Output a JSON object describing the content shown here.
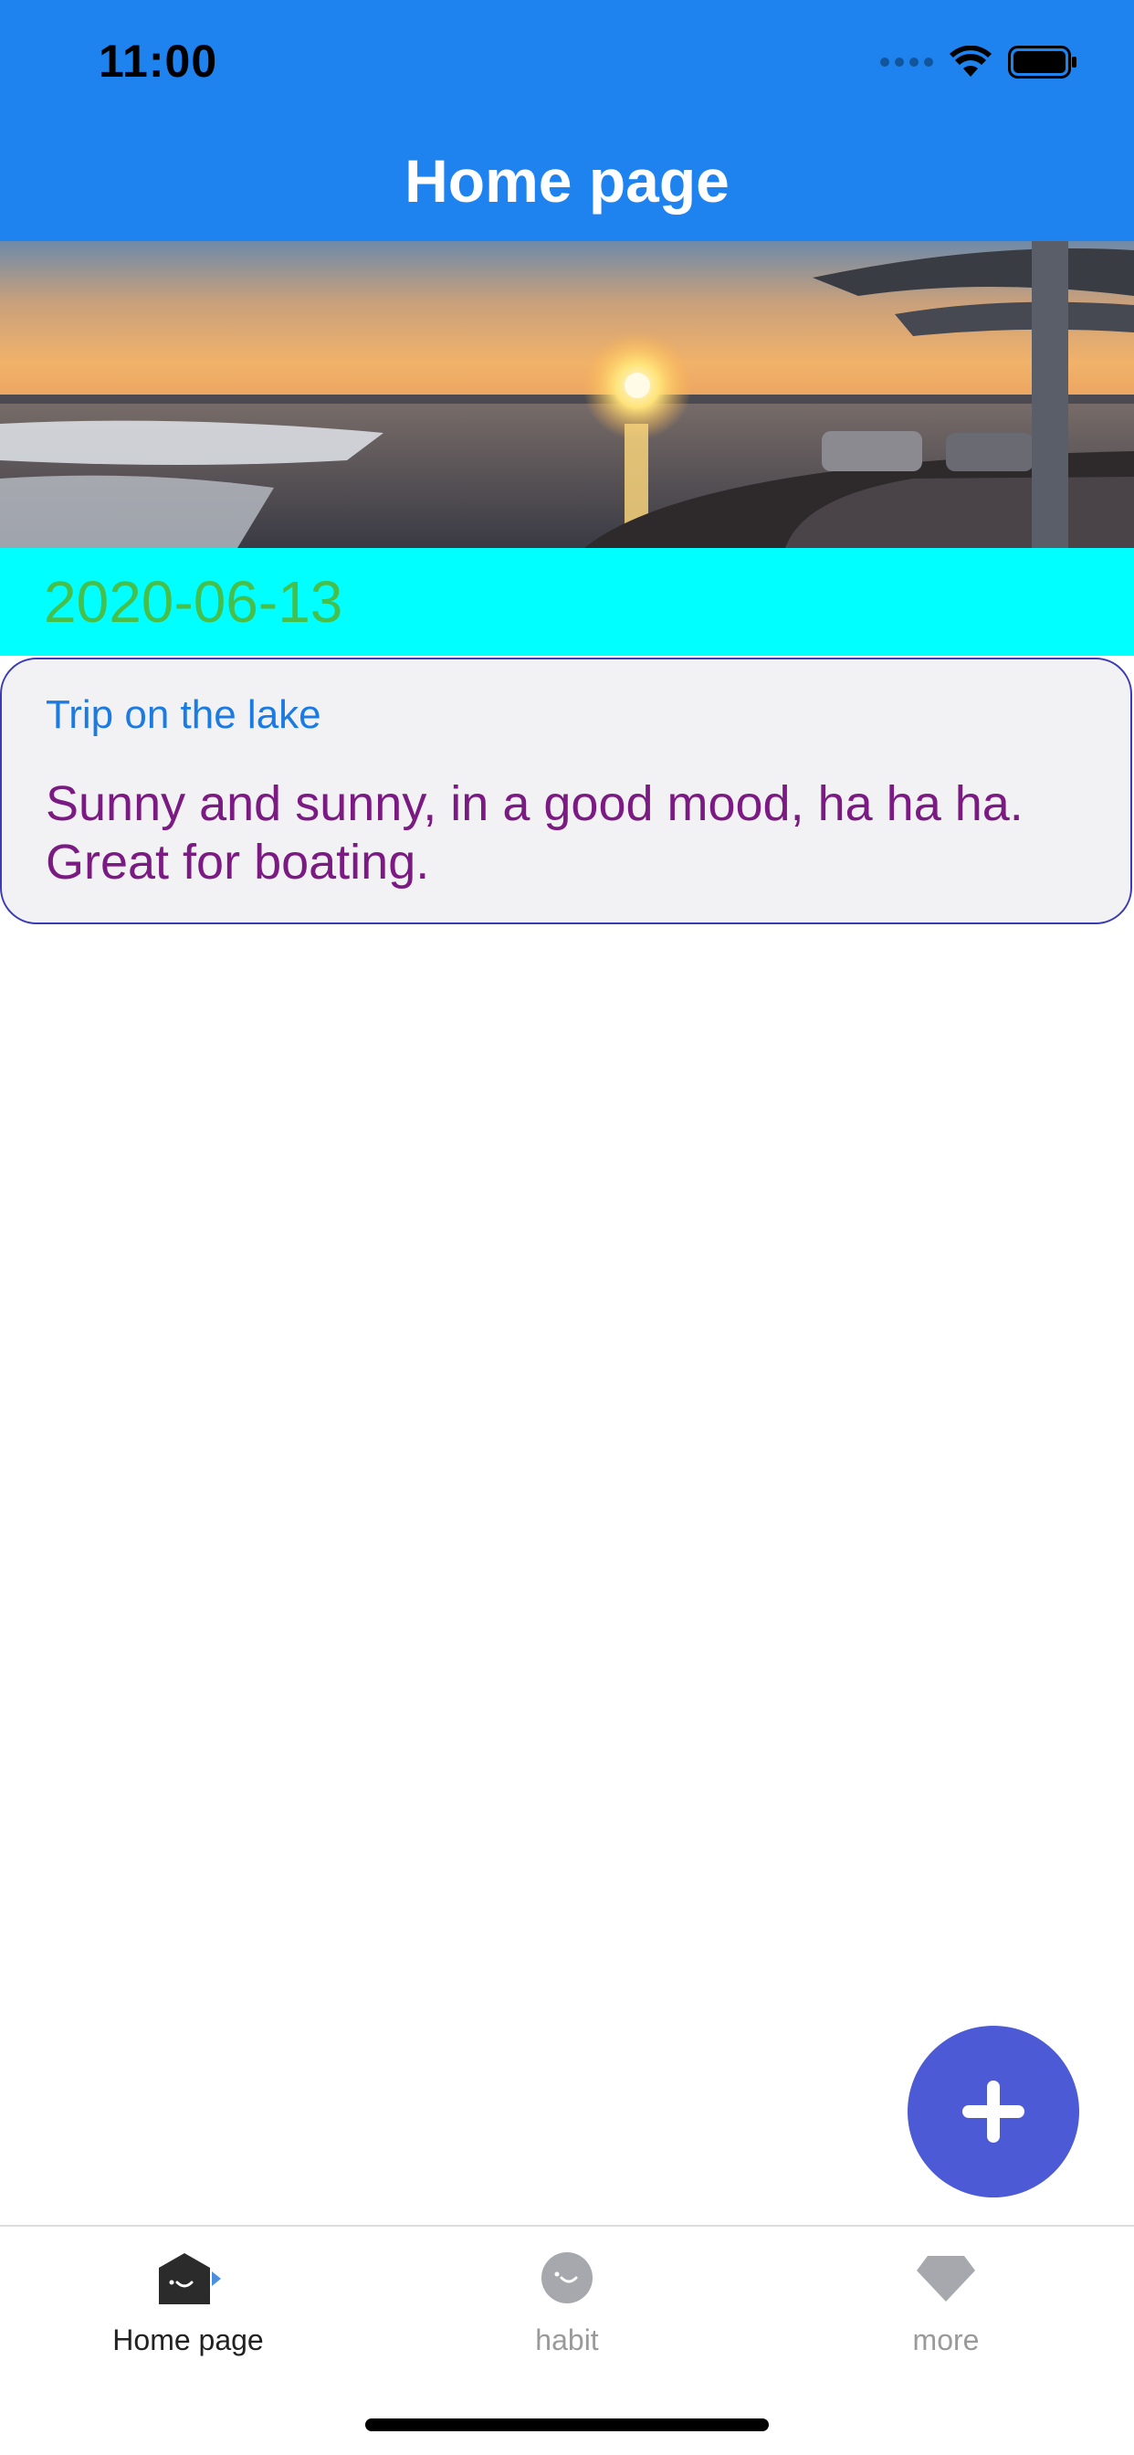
{
  "status_bar": {
    "time": "11:00"
  },
  "nav": {
    "title": "Home page"
  },
  "banner": {
    "image": "sunset-lake-photo"
  },
  "entry": {
    "date": "2020-06-13",
    "title": "Trip on the lake",
    "body": "Sunny and sunny, in a good mood, ha ha ha. Great for boating."
  },
  "fab": {
    "icon": "plus-icon"
  },
  "tabbar": {
    "tabs": [
      {
        "label": "Home page",
        "icon": "home-icon",
        "active": true
      },
      {
        "label": "habit",
        "icon": "smiley-icon",
        "active": false
      },
      {
        "label": "more",
        "icon": "diamond-icon",
        "active": false
      }
    ]
  },
  "colors": {
    "header": "#1E83EE",
    "date_strip": "#00FFFF",
    "date_text": "#46C04A",
    "entry_title": "#1B7BE2",
    "entry_body": "#7A1A82",
    "fab": "#4C5AD6"
  }
}
